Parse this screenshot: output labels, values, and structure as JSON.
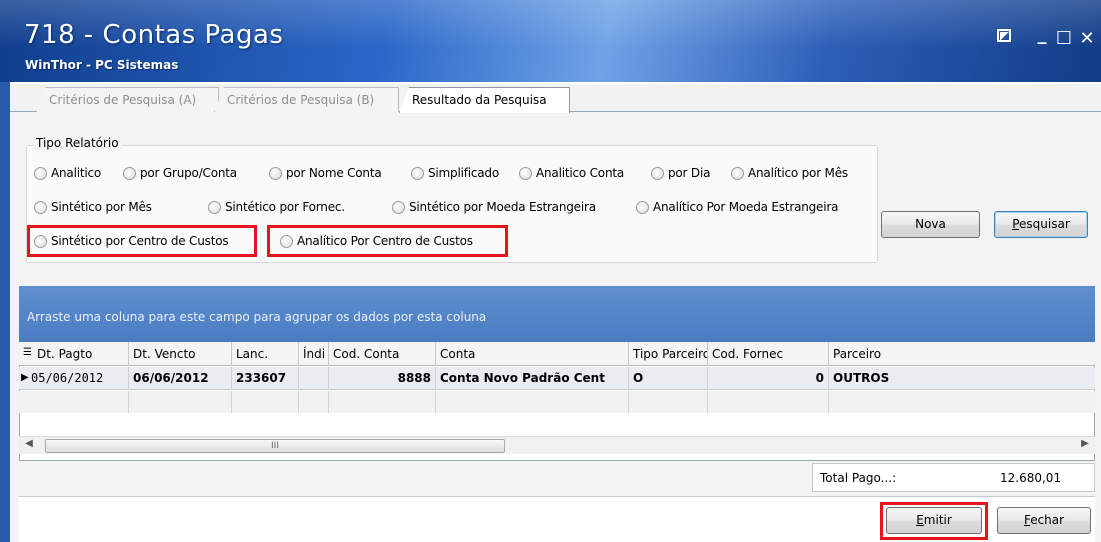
{
  "window": {
    "title": "718 - Contas Pagas",
    "subtitle": "WinThor - PC Sistemas",
    "controls": [
      "pin-icon",
      "minimize-icon",
      "maximize-icon",
      "close-icon"
    ]
  },
  "tabs": [
    {
      "label": "Critérios de Pesquisa (A)",
      "active": false
    },
    {
      "label": "Critérios de Pesquisa (B)",
      "active": false
    },
    {
      "label": "Resultado da Pesquisa",
      "active": true
    }
  ],
  "tipo_relatorio": {
    "label": "Tipo Relatório",
    "row1": [
      "Analitico",
      "por Grupo/Conta",
      "por Nome Conta",
      "Simplificado",
      "Analitico Conta",
      "por Dia",
      "Analítico por Mês"
    ],
    "row2": [
      "Sintético por Mês",
      "Sintético por Fornec.",
      "Sintético por Moeda Estrangeira",
      "Analítico Por Moeda Estrangeira"
    ],
    "row3": [
      "Sintético por Centro de Custos",
      "Analítico Por Centro de Custos"
    ]
  },
  "buttons": {
    "nova": "Nova",
    "pesquisar_first": "P",
    "pesquisar_rest": "esquisar",
    "emitir_first": "E",
    "emitir_rest": "mitir",
    "fechar_first": "F",
    "fechar_rest": "echar"
  },
  "grid": {
    "group_hint": "Arraste uma coluna para este campo para agrupar os dados por esta coluna",
    "columns": [
      "Dt. Pagto",
      "Dt. Vencto",
      "Lanc.",
      "Índi",
      "Cod. Conta",
      "Conta",
      "Tipo Parceiro",
      "Cod. Fornec",
      "Parceiro"
    ],
    "rows": [
      [
        "05/06/2012",
        "06/06/2012",
        "233607",
        "",
        "8888",
        "Conta Novo Padrão Cent",
        "O",
        "0",
        "OUTROS"
      ]
    ]
  },
  "totals": {
    "label": "Total Pago...:",
    "value": "12.680,01"
  },
  "colors": {
    "highlight": "#e8141c",
    "title_bar": "#2a67c8",
    "group_header": "#5580c4"
  }
}
